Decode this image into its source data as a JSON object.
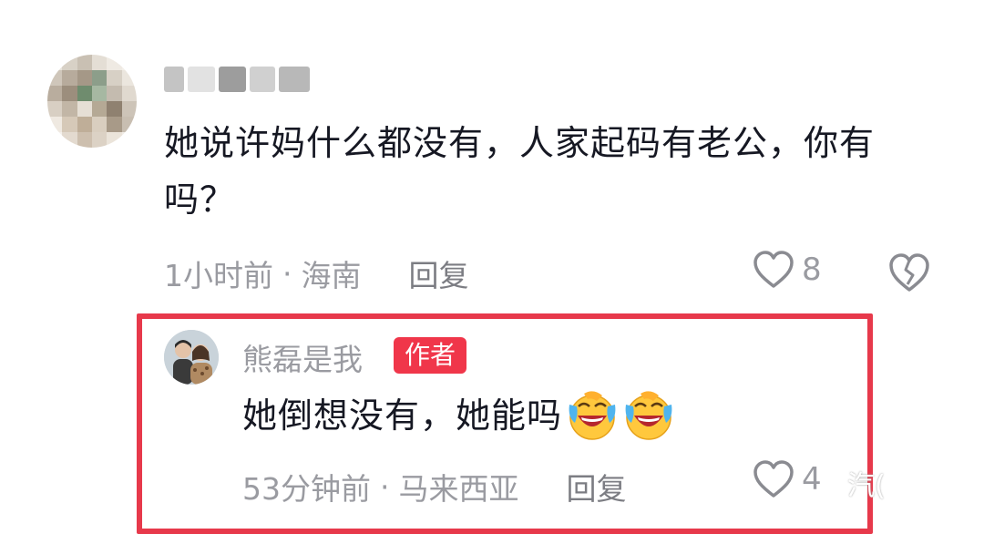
{
  "comment": {
    "text": "她说许妈什么都没有，人家起码有老公，你有吗？",
    "time": "1小时前",
    "separator": "·",
    "location": "海南",
    "reply_label": "回复",
    "like_count": "8"
  },
  "author_reply": {
    "username": "熊磊是我",
    "badge": "作者",
    "text": "她倒想没有，她能吗",
    "emoji": "laughing-crying-emoji",
    "time": "53分钟前",
    "separator": "·",
    "location": "马来西亚",
    "reply_label": "回复",
    "like_count": "4"
  },
  "watermark": "汽(",
  "colors": {
    "highlight_border": "#e7394b",
    "badge_bg": "#f0364a",
    "muted_text": "#9a9ba1"
  }
}
